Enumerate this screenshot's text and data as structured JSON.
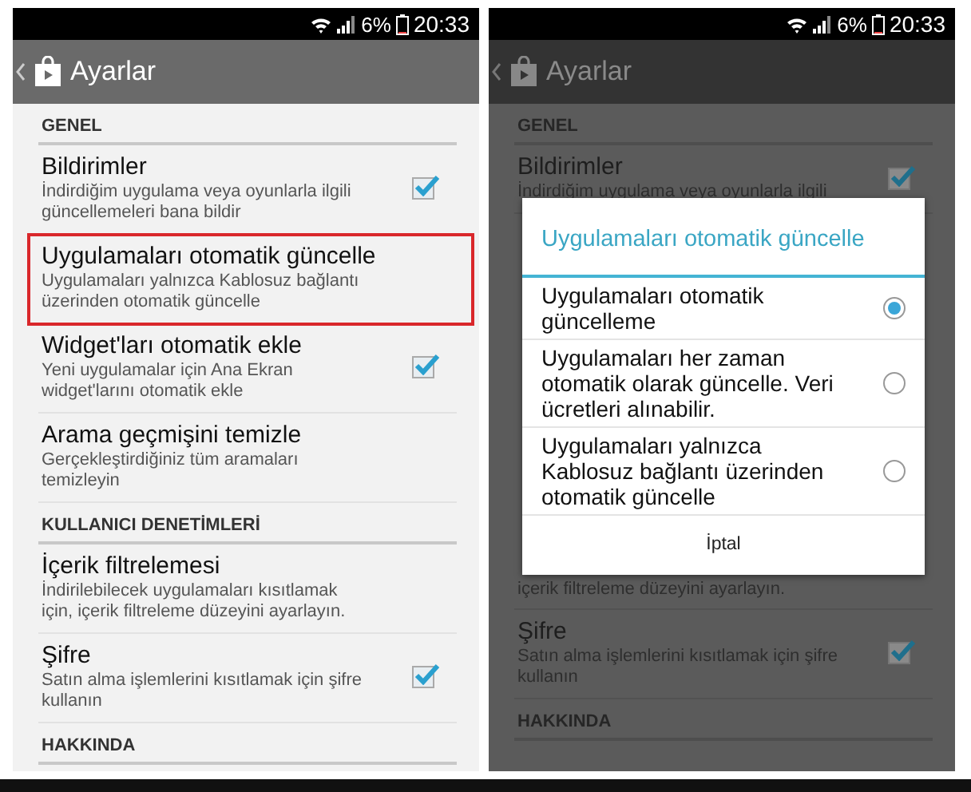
{
  "screens": [
    {
      "status_bar": {
        "battery": "6%",
        "time": "20:33"
      },
      "app_bar": {
        "title": "Ayarlar"
      },
      "dimmed": false,
      "items": [
        {
          "kind": "header",
          "label": "GENEL"
        },
        {
          "kind": "setting",
          "title": "Bildirimler",
          "subtitle": "İndirdiğim uygulama veya oyunlarla ilgili güncellemeleri bana bildir",
          "checked": true,
          "highlighted": false
        },
        {
          "kind": "setting",
          "title": "Uygulamaları otomatik güncelle",
          "subtitle": "Uygulamaları yalnızca Kablosuz bağlantı üzerinden otomatik güncelle",
          "highlighted": true
        },
        {
          "kind": "setting",
          "title": "Widget'ları otomatik ekle",
          "subtitle": "Yeni uygulamalar için Ana Ekran widget'larını otomatik ekle",
          "checked": true,
          "highlighted": false
        },
        {
          "kind": "setting",
          "title": "Arama geçmişini temizle",
          "subtitle": "Gerçekleştirdiğiniz tüm aramaları temizleyin",
          "highlighted": false
        },
        {
          "kind": "header",
          "label": "KULLANICI DENETİMLERİ"
        },
        {
          "kind": "setting",
          "title": "İçerik filtrelemesi",
          "subtitle": "İndirilebilecek uygulamaları kısıtlamak için, içerik filtreleme düzeyini ayarlayın.",
          "highlighted": false
        },
        {
          "kind": "setting",
          "title": "Şifre",
          "subtitle": "Satın alma işlemlerini kısıtlamak için şifre kullanın",
          "checked": true,
          "highlighted": false
        },
        {
          "kind": "header",
          "label": "HAKKINDA"
        }
      ]
    },
    {
      "status_bar": {
        "battery": "6%",
        "time": "20:33"
      },
      "app_bar": {
        "title": "Ayarlar"
      },
      "dimmed": true,
      "items": [
        {
          "kind": "header",
          "label": "GENEL"
        },
        {
          "kind": "setting",
          "title": "Bildirimler",
          "subtitle": "İndirdiğim uygulama veya oyunlarla ilgili",
          "checked": true,
          "highlighted": false
        },
        {
          "kind": "dialog",
          "title": "Uygulamaları otomatik güncelle",
          "options": [
            {
              "label": "Uygulamaları otomatik güncelleme",
              "selected": true
            },
            {
              "label": "Uygulamaları her zaman otomatik olarak güncelle. Veri ücretleri alınabilir.",
              "selected": false
            },
            {
              "label": "Uygulamaları yalnızca Kablosuz bağlantı üzerinden otomatik güncelle",
              "selected": false
            }
          ],
          "button": "İptal"
        },
        {
          "kind": "setting",
          "subtitle": "içerik filtreleme düzeyini ayarlayın.",
          "highlighted": false
        },
        {
          "kind": "setting",
          "title": "Şifre",
          "subtitle": "Satın alma işlemlerini kısıtlamak için şifre kullanın",
          "checked": true,
          "highlighted": false
        },
        {
          "kind": "header",
          "label": "HAKKINDA"
        }
      ]
    }
  ]
}
